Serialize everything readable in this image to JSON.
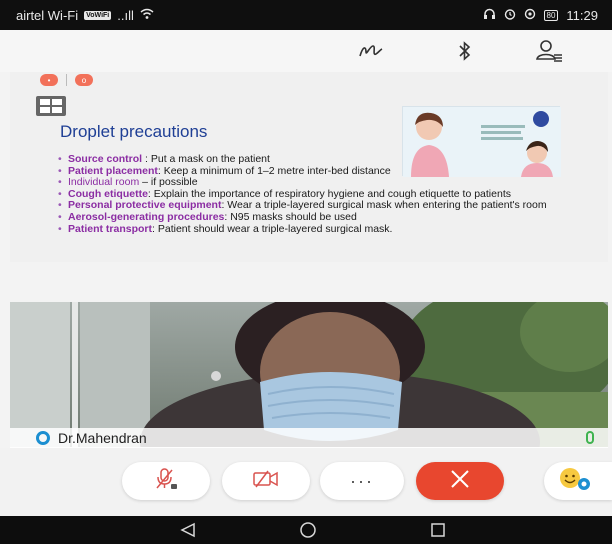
{
  "status_bar": {
    "carrier": "airtel Wi-Fi",
    "volte_badge": "VoWiFi",
    "signal": "..ıll",
    "battery": "80",
    "time": "11:29"
  },
  "slide": {
    "title": "Droplet precautions",
    "bullets": [
      {
        "label": "Source control",
        "text": " : Put a mask on the patient"
      },
      {
        "label": "Patient placement",
        "text": ": Keep a minimum of 1–2 metre inter-bed distance"
      },
      {
        "label": "Individual room",
        "text": " – if possible"
      },
      {
        "label": "Cough etiquette",
        "text": ": Explain the importance of respiratory hygiene and cough etiquette to patients"
      },
      {
        "label": "Personal protective equipment",
        "text": ": Wear a triple-layered surgical mask when entering the patient's room"
      },
      {
        "label": "Aerosol-generating procedures",
        "text": ": N95 masks should be used"
      },
      {
        "label": "Patient transport",
        "text": ": Patient should wear a triple-layered surgical mask."
      }
    ]
  },
  "participant": {
    "name": "Dr.Mahendran"
  },
  "controls": {
    "more_label": "···"
  },
  "icons": {
    "toolbar": [
      "pen-icon",
      "bluetooth-icon",
      "participants-icon"
    ],
    "controls": [
      "mic-muted-icon",
      "camera-off-icon",
      "more-icon",
      "end-call-icon",
      "emoji-icon"
    ],
    "nav": [
      "back-icon",
      "home-icon",
      "recents-icon"
    ]
  },
  "colors": {
    "slide_title": "#1f3f95",
    "bullet_label": "#8b2da3",
    "end_call": "#e8472f",
    "reaction": "#f2715a",
    "mic_active": "#3fb34f",
    "avatar_ring": "#1c8fd1"
  }
}
